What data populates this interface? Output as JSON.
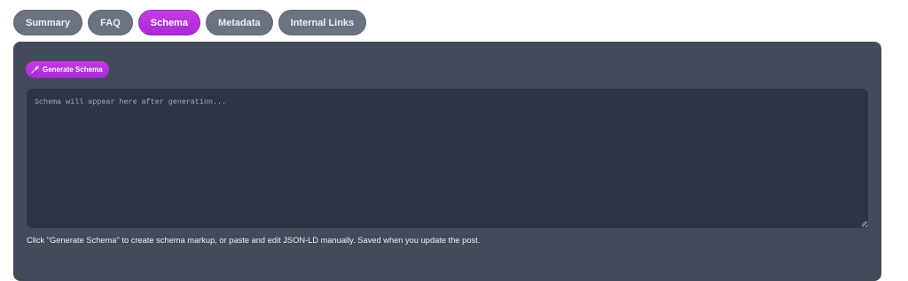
{
  "tabs": [
    {
      "label": "Summary",
      "active": false
    },
    {
      "label": "FAQ",
      "active": false
    },
    {
      "label": "Schema",
      "active": true
    },
    {
      "label": "Metadata",
      "active": false
    },
    {
      "label": "Internal Links",
      "active": false
    }
  ],
  "schema_panel": {
    "generate_button_label": "Generate Schema",
    "generate_button_icon": "magic-wand-icon",
    "editor_placeholder": "Schema will appear here after generation...",
    "editor_value": "",
    "help_text": "Click \"Generate Schema\" to create schema markup, or paste and edit JSON-LD manually. Saved when you update the post."
  },
  "colors": {
    "accent": "#b333dd",
    "tab_inactive": "#6b7280",
    "panel_bg": "#434b5a",
    "editor_bg": "#2d3446"
  }
}
